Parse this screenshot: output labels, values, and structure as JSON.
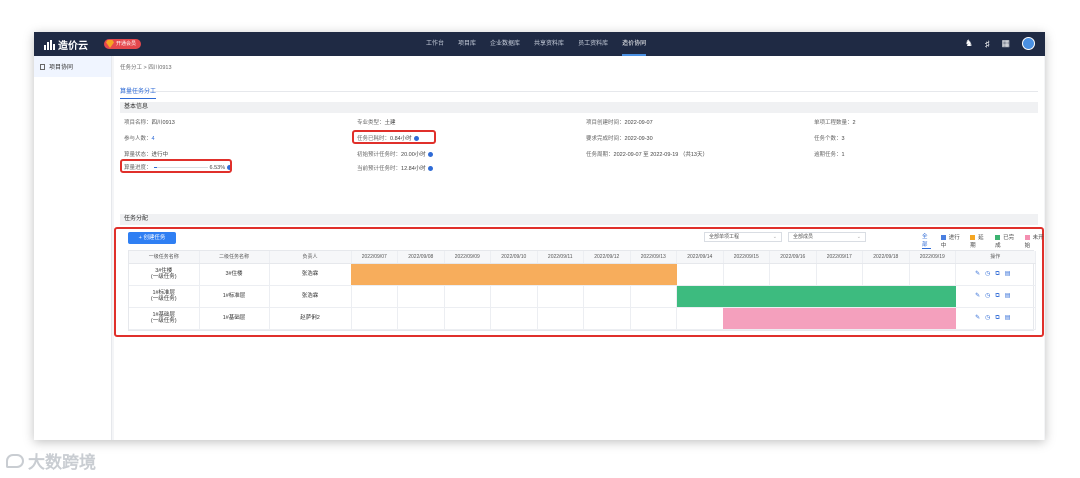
{
  "topbar": {
    "logo": "造价云",
    "vip_badge": "开通会员",
    "nav": [
      "工作台",
      "项目库",
      "企业数据库",
      "共享资料库",
      "员工资料库",
      "造价协同"
    ],
    "active_nav": 5
  },
  "sidebar": {
    "items": [
      {
        "label": "项目协同"
      }
    ]
  },
  "breadcrumb": "任务分工 > 四川0913",
  "tab": "算量任务分工",
  "basic": {
    "title": "基本信息",
    "project_name": {
      "label": "项目名称：",
      "value": "四川0913"
    },
    "participants": {
      "label": "参与人数：",
      "value": "4"
    },
    "status": {
      "label": "算量状态：",
      "value": "进行中"
    },
    "progress": {
      "label": "算量进度：",
      "value": "6.53%",
      "fraction": 0.0653
    },
    "specialty": {
      "label": "专业类型：",
      "value": "土建"
    },
    "used_time": {
      "label": "任务已耗时：",
      "value": "0.84小时"
    },
    "initial_est": {
      "label": "初始预计任务时：",
      "value": "20.00小时"
    },
    "current_est": {
      "label": "当前预计任务时：",
      "value": "12.84小时"
    },
    "created_time": {
      "label": "项目创建时间：",
      "value": "2022-09-07"
    },
    "required_time": {
      "label": "要求完成时间：",
      "value": "2022-09-30"
    },
    "task_period": {
      "label": "任务周期：",
      "value": "2022-09-07 至 2022-09-19 （共13天）"
    },
    "unit_count": {
      "label": "单项工程数量：",
      "value": "2"
    },
    "task_count": {
      "label": "任务个数：",
      "value": "3"
    },
    "overdue": {
      "label": "逾期任务：",
      "value": "1"
    }
  },
  "assign": {
    "title": "任务分配",
    "create_button": "+ 创建任务",
    "filter_unit": "全部单项工程",
    "filter_member": "全部成员",
    "legend": [
      {
        "label": "全部",
        "color": ""
      },
      {
        "label": "进行中",
        "color": "#4a7fe0"
      },
      {
        "label": "延期",
        "color": "#f5a623"
      },
      {
        "label": "已完成",
        "color": "#3cb371"
      },
      {
        "label": "未开始",
        "color": "#f48fb1"
      }
    ]
  },
  "gantt": {
    "columns": {
      "level1": "一级任务名称",
      "level2": "二级任务名称",
      "owner": "负责人",
      "ops": "操作"
    },
    "dates": [
      "2022/09/07",
      "2022/09/08",
      "2022/09/09",
      "2022/09/10",
      "2022/09/11",
      "2022/09/12",
      "2022/09/13",
      "2022/09/14",
      "2022/09/15",
      "2022/09/16",
      "2022/09/17",
      "2022/09/18",
      "2022/09/19"
    ],
    "rows": [
      {
        "level1a": "3#住楼",
        "level1b": "(一级任务)",
        "level2": "3#住楼",
        "owner": "张浩霖",
        "start": 0,
        "end": 7,
        "status_color": "#f7ad5c"
      },
      {
        "level1a": "1#标准层",
        "level1b": "(一级任务)",
        "level2": "1#标准层",
        "owner": "张浩霖",
        "start": 7,
        "end": 13,
        "status_color": "#3dbb7f"
      },
      {
        "level1a": "1#基础层",
        "level1b": "(一级任务)",
        "level2": "1#基础层",
        "owner": "赵萨俐2",
        "start": 8,
        "end": 13,
        "status_color": "#f4a0bd"
      }
    ],
    "ops_icons": [
      "edit-icon",
      "clock-icon",
      "copy-icon",
      "delete-icon"
    ]
  },
  "watermark": "大数跨境"
}
